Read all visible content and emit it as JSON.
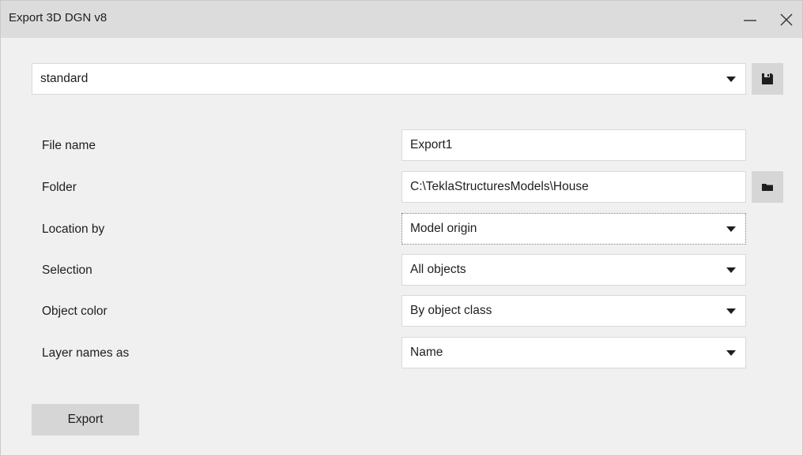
{
  "window": {
    "title": "Export 3D DGN v8",
    "minimize_icon": "minimize-icon",
    "close_icon": "close-icon"
  },
  "settings": {
    "selected": "standard",
    "save_icon": "save-icon"
  },
  "form": {
    "file_name": {
      "label": "File name",
      "value": "Export1"
    },
    "folder": {
      "label": "Folder",
      "value": "C:\\TeklaStructuresModels\\House",
      "browse_icon": "folder-icon"
    },
    "location_by": {
      "label": "Location by",
      "value": "Model origin"
    },
    "selection": {
      "label": "Selection",
      "value": "All objects"
    },
    "object_color": {
      "label": "Object color",
      "value": "By object class"
    },
    "layer_names_as": {
      "label": "Layer names as",
      "value": "Name"
    }
  },
  "actions": {
    "export_label": "Export"
  },
  "colors": {
    "titlebar": "#dcdcdc",
    "background": "#f0f0f0",
    "button": "#d6d6d6",
    "text": "#1e1e1e"
  }
}
